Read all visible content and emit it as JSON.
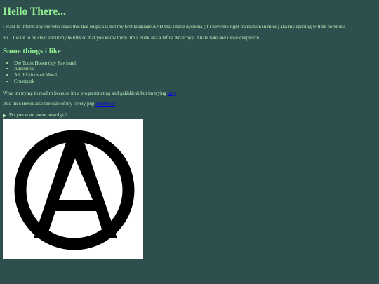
{
  "header": {
    "title": "Hello There..."
  },
  "intro": {
    "paragraph1": "I want to inform anyone who reads this that english is not my first language AND that i have dyslexia (if i have the right translation in mind) aka my spelling will be horendus",
    "paragraph2": "So... I want to be clear about my belifes so that you know them. Im a Punk aka a leftist Anarchyst. I hate hate and i love exeptence."
  },
  "likes": {
    "heading": "Some things i like",
    "items": [
      "Die Toten Hosen (my Fav band",
      "Ancomred",
      "All dif kinds of Metal",
      "Crustpunk"
    ]
  },
  "reading": {
    "text": "What im trying to read rn because im a progrestinating and gahhhhhh but im trying ",
    "link": "help"
  },
  "pup": {
    "text": "And then theres also the side of my lovely pup ",
    "link": "ancomred"
  },
  "nostalgia": {
    "summary": "Do you want some nostolgia?"
  },
  "image": {
    "icon": "anarchy-symbol-icon",
    "background": "#ffffff",
    "foreground": "#000000"
  },
  "colors": {
    "background": "#2f4f4f",
    "text": "#b3f0b3",
    "heading": "#90ee90",
    "link": "#0000ee"
  }
}
